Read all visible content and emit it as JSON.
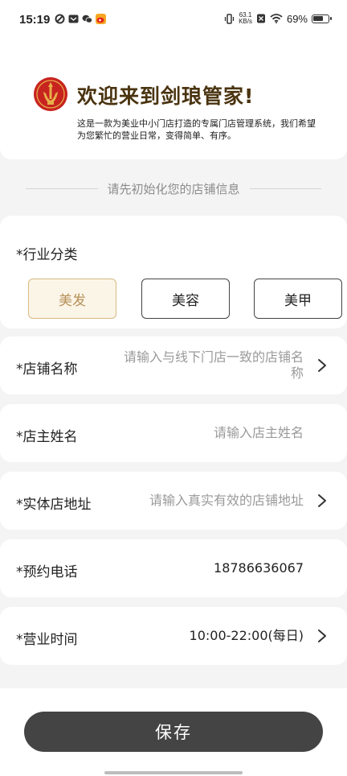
{
  "status_bar": {
    "time": "15:19",
    "net_speed_value": "63.1",
    "net_speed_unit": "KB/s",
    "battery_percent": "69%",
    "battery_level": 0.69
  },
  "welcome": {
    "title": "欢迎来到剑琅管家!",
    "description": "这是一款为美业中小门店打造的专属门店管理系统，我们希望为您繁忙的营业日常，变得简单、有序。"
  },
  "section_title": "请先初始化您的店铺信息",
  "industry": {
    "label": "*行业分类",
    "options": [
      "美发",
      "美容",
      "美甲"
    ],
    "selected": "美发"
  },
  "fields": {
    "store_name": {
      "label": "*店铺名称",
      "placeholder": "请输入与线下门店一致的店铺名称"
    },
    "owner_name": {
      "label": "*店主姓名",
      "placeholder": "请输入店主姓名"
    },
    "address": {
      "label": "*实体店地址",
      "placeholder": "请输入真实有效的店铺地址"
    },
    "phone": {
      "label": "*预约电话",
      "value": "18786636067"
    },
    "hours": {
      "label": "*营业时间",
      "value": "10:00-22:00(每日)"
    }
  },
  "save_label": "保存",
  "colors": {
    "accent_gold": "#b79158",
    "title_brown": "#4a3410",
    "button_dark": "#444444",
    "logo_red": "#c8241f"
  }
}
